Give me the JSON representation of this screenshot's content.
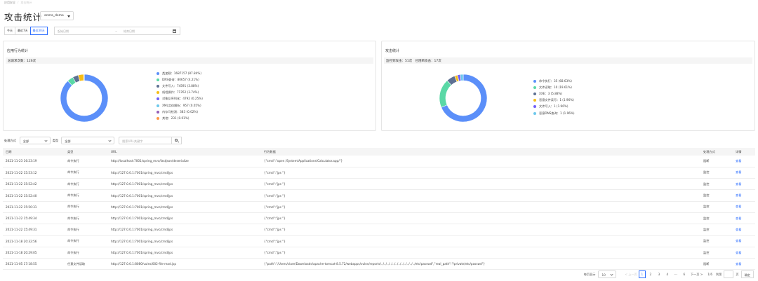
{
  "breadcrumb": [
    "应用安全",
    "攻击统计"
  ],
  "page_title": "攻击统计",
  "app_select": "anma_demo",
  "date_buttons": [
    "今天",
    "最近7天",
    "最近30天"
  ],
  "date_range": {
    "start_placeholder": "起始日期",
    "end_placeholder": "结束日期"
  },
  "app_behavior": {
    "title": "应用行为统计",
    "total": "总请求次数：126次",
    "legend": [
      {
        "label": "类加载：1687157 (87.84%)",
        "color": "#5b8ff9",
        "value": 1687157
      },
      {
        "label": "DNS查询：80657 (4.21%)",
        "color": "#5ad8a6",
        "value": 80657
      },
      {
        "label": "文件写入：74591 (3.88%)",
        "color": "#5d7092",
        "value": 74591
      },
      {
        "label": "线程操作：71762 (3.74%)",
        "color": "#f6bd16",
        "value": 71762
      },
      {
        "label": "对象反序列化：4792 (0.25%)",
        "color": "#6f5ef9",
        "value": 4792
      },
      {
        "label": "XML实体解析：957 (0.05%)",
        "color": "#6dc8ec",
        "value": 957
      },
      {
        "label": "内存马检测：383 (0.02%)",
        "color": "#945fb9",
        "value": 383
      },
      {
        "label": "其他：231 (0.01%)",
        "color": "#ff9845",
        "value": 231
      }
    ]
  },
  "attack_stats": {
    "title": "攻击统计",
    "monitored": "监控到攻击：51次",
    "blocked": "已阻断攻击：17次",
    "legend": [
      {
        "label": "命令执行：35 (68.63%)",
        "color": "#5b8ff9",
        "value": 35
      },
      {
        "label": "文件读取：10 (19.61%)",
        "color": "#5ad8a6",
        "value": 10
      },
      {
        "label": "XXE：3 (5.88%)",
        "color": "#5d7092",
        "value": 3
      },
      {
        "label": "恶意文件读写：1 (1.96%)",
        "color": "#f6bd16",
        "value": 1
      },
      {
        "label": "文件写入：1 (1.96%)",
        "color": "#6f5ef9",
        "value": 1
      },
      {
        "label": "恶意DNS查询：1 (1.96%)",
        "color": "#6dc8ec",
        "value": 1
      }
    ]
  },
  "filters": {
    "method_label": "处理方式",
    "method_value": "全部",
    "type_label": "类型",
    "type_value": "全部",
    "search_placeholder": "搜索URL关键字"
  },
  "table": {
    "headers": [
      "日期",
      "类型",
      "URL",
      "行为数据",
      "处理方式",
      "详情"
    ],
    "rows": [
      [
        "2021-11-23 16:23:19",
        "命令执行",
        "http://localhost:7001/spring_mvc/fastjson/deserialize",
        "{\"cmd\":\"open /System/Applications/Calculator.app/\"}",
        "阻断",
        "查看"
      ],
      [
        "2021-11-22 15:53:12",
        "命令执行",
        "http://127.0.0.1:7001/spring_mvc/cmd/jps",
        "{\"cmd\":\"jps \"}",
        "监控",
        "查看"
      ],
      [
        "2021-11-22 15:52:42",
        "命令执行",
        "http://127.0.0.1:7001/spring_mvc/cmd/jps",
        "{\"cmd\":\"jps \"}",
        "监控",
        "查看"
      ],
      [
        "2021-11-22 15:52:40",
        "命令执行",
        "http://127.0.0.1:7001/spring_mvc/cmd/jps",
        "{\"cmd\":\"jps \"}",
        "监控",
        "查看"
      ],
      [
        "2021-11-22 15:50:31",
        "命令执行",
        "http://127.0.0.1:7001/spring_mvc/cmd/jps",
        "{\"cmd\":\"jps \"}",
        "监控",
        "查看"
      ],
      [
        "2021-11-22 15:49:34",
        "命令执行",
        "http://127.0.0.1:7001/spring_mvc/cmd/jps",
        "{\"cmd\":\"jps \"}",
        "监控",
        "查看"
      ],
      [
        "2021-11-22 15:49:31",
        "命令执行",
        "http://127.0.0.1:7001/spring_mvc/cmd/jps",
        "{\"cmd\":\"jps \"}",
        "监控",
        "查看"
      ],
      [
        "2021-11-18 20:32:56",
        "命令执行",
        "http://127.0.0.1:7001/spring_mvc/cmd/jps",
        "{\"cmd\":\"jps \"}",
        "监控",
        "查看"
      ],
      [
        "2021-11-18 20:29:05",
        "命令执行",
        "http://127.0.0.1:7001/spring_mvc/cmd/jps",
        "{\"cmd\":\"jps \"}",
        "监控",
        "查看"
      ],
      [
        "2021-11-05 17:18:55",
        "任意文件读取",
        "http://127.0.0.1:8080/vulns/002-file-read.jsp",
        "{\"path\":\"/Users/clare/Downloads/apache-tomcat-8.5.72/webapps/vulns/reports/../../../../../../../../../../../../etc/passwd\",\"real_path\":\"/private/etc/passwd\"}",
        "阻断",
        "查看"
      ]
    ]
  },
  "pagination": {
    "page_size_label": "每页显示",
    "page_size": "10",
    "prev": "< 上一页",
    "pages": [
      "1",
      "2",
      "3",
      "4",
      "···",
      "6"
    ],
    "next": "下一页 >",
    "total": "1/6",
    "goto": "到第",
    "page_unit": "页",
    "confirm": "确定"
  }
}
